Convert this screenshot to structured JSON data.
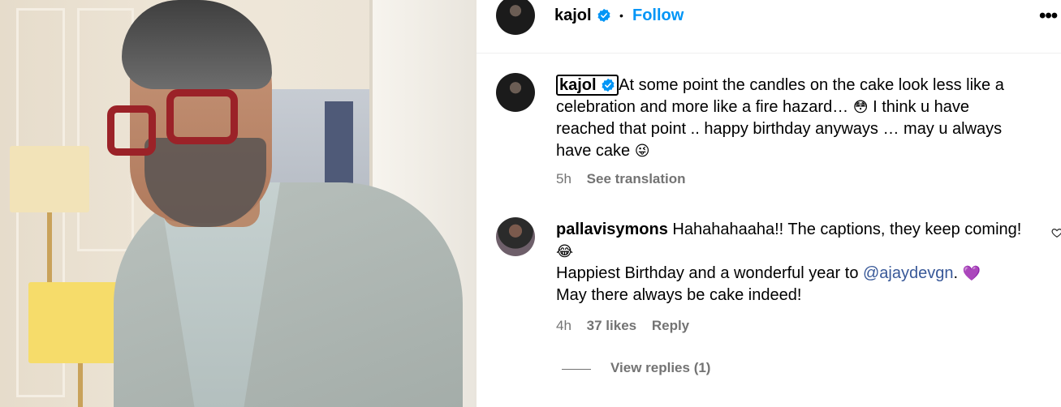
{
  "post": {
    "author": "kajol",
    "verified": true,
    "follow_label": "Follow",
    "separator": "•",
    "more_icon": "more-options-icon"
  },
  "comments": [
    {
      "username": "kajol",
      "verified": true,
      "text_lines": [
        "At some point the candles on the cake look less like a",
        "celebration and more like a fire hazard… ",
        " I think u have",
        "reached that point .. happy birthday anyways … may u always",
        "have cake "
      ],
      "emoji_1": "😳",
      "emoji_2": "😜",
      "time": "5h",
      "see_translation": "See translation"
    },
    {
      "username": "pallavisymons",
      "text_lines": [
        "Hahahahaaha!! The captions, they keep coming!",
        "Happiest Birthday and a wonderful year to ",
        ".",
        "May there always be cake indeed!"
      ],
      "emoji_laugh": "😂",
      "emoji_heart": "💜",
      "mention": "@ajaydevgn",
      "time": "4h",
      "likes": "37 likes",
      "reply_label": "Reply",
      "view_replies": "View replies (1)"
    }
  ],
  "colors": {
    "link": "#0095f6",
    "muted": "#737373",
    "mention": "#385898",
    "verified": "#0095f6"
  }
}
